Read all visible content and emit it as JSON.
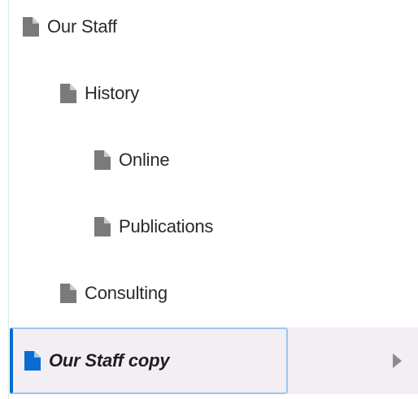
{
  "tree": {
    "items": [
      {
        "label": "Our Staff",
        "level": 0,
        "icon": "document-icon",
        "selected": false
      },
      {
        "label": "History",
        "level": 1,
        "icon": "document-icon",
        "selected": false
      },
      {
        "label": "Online",
        "level": 2,
        "icon": "document-icon",
        "selected": false
      },
      {
        "label": "Publications",
        "level": 2,
        "icon": "document-icon",
        "selected": false
      },
      {
        "label": "Consulting",
        "level": 1,
        "icon": "document-icon",
        "selected": false
      },
      {
        "label": "Our Staff copy",
        "level": 0,
        "icon": "document-icon",
        "selected": true,
        "has_children_arrow": true
      }
    ]
  },
  "colors": {
    "icon_default": "#7a7a7a",
    "icon_selected": "#0a6cd0",
    "selection_background": "#f2eef3",
    "selection_border": "#9cc7ef",
    "selection_accent": "#0a6cd0",
    "arrow": "#8a8a8a"
  }
}
